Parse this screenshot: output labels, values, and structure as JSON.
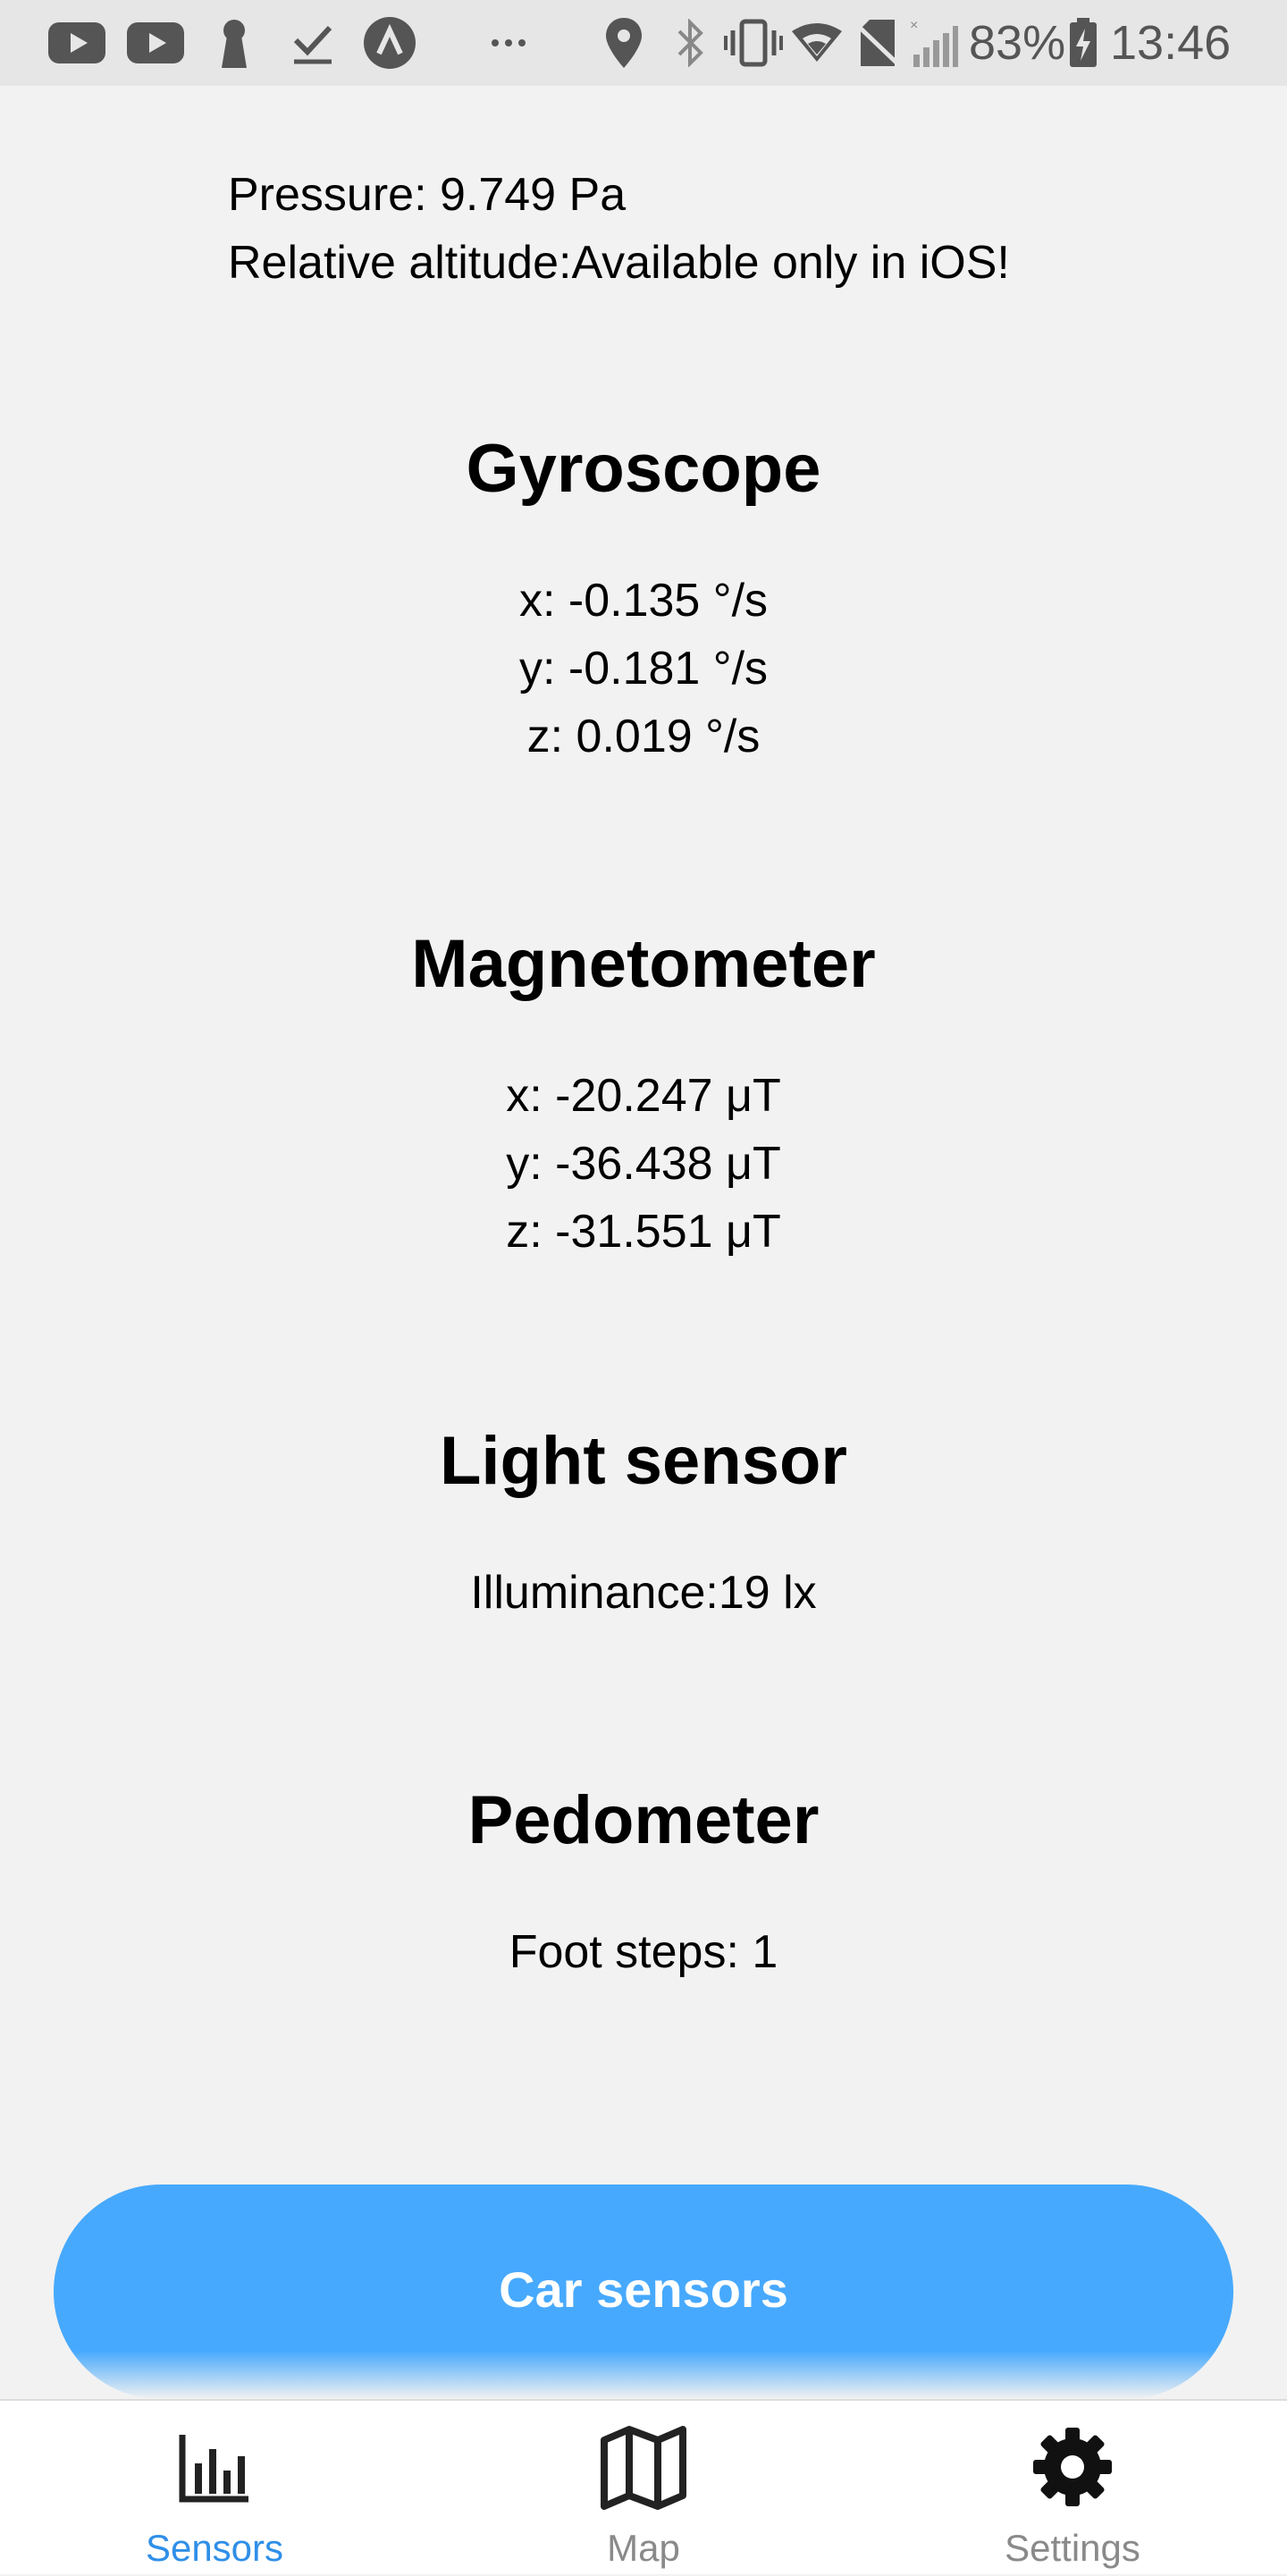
{
  "status_bar": {
    "battery_percent": "83%",
    "time": "13:46",
    "icons": [
      "youtube-icon",
      "youtube-icon",
      "keyhole-icon",
      "checkmark-icon",
      "vpn-icon",
      "more-dots-icon",
      "location-pin-icon",
      "bluetooth-icon",
      "vibrate-icon",
      "wifi-icon",
      "no-sim-icon",
      "signal-icon",
      "battery-charging-icon"
    ]
  },
  "pressure": {
    "pressure_line": "Pressure: 9.749 Pa",
    "altitude_line": "Relative altitude:Available only in iOS!"
  },
  "gyroscope": {
    "title": "Gyroscope",
    "x": "x: -0.135 °/s",
    "y": "y: -0.181 °/s",
    "z": "z: 0.019 °/s"
  },
  "magnetometer": {
    "title": "Magnetometer",
    "x": "x: -20.247 μT",
    "y": "y: -36.438 μT",
    "z": "z: -31.551 μT"
  },
  "light_sensor": {
    "title": "Light sensor",
    "illuminance": "Illuminance:19 lx"
  },
  "pedometer": {
    "title": "Pedometer",
    "steps": "Foot steps: 1"
  },
  "car_button": {
    "label": "Car sensors",
    "color": "#47a9fd"
  },
  "bottom_nav": {
    "active_color": "#2f8fe8",
    "inactive_color": "#8a8a8a",
    "items": [
      {
        "label": "Sensors",
        "icon": "bar-chart-icon",
        "active": true
      },
      {
        "label": "Map",
        "icon": "map-icon",
        "active": false
      },
      {
        "label": "Settings",
        "icon": "gear-icon",
        "active": false
      }
    ]
  }
}
